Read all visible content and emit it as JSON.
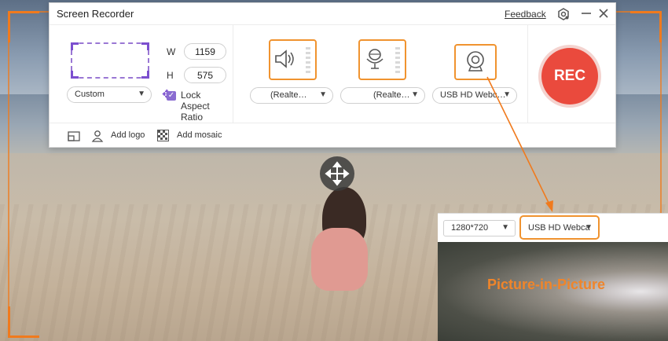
{
  "window": {
    "title": "Screen Recorder",
    "feedback": "Feedback",
    "icons": [
      "settings-icon",
      "minimize-icon",
      "close-icon"
    ]
  },
  "region": {
    "width_label": "W",
    "width_value": "1159",
    "height_label": "H",
    "height_value": "575",
    "preset": "Custom",
    "lock_aspect_label": "Lock Aspect Ratio",
    "lock_aspect_checked": true
  },
  "devices": {
    "speaker": {
      "icon": "speaker-icon",
      "select": "(Realte…"
    },
    "microphone": {
      "icon": "microphone-icon",
      "select": "(Realte…"
    },
    "webcam": {
      "icon": "webcam-icon",
      "select": "USB HD Webc…"
    }
  },
  "rec_label": "REC",
  "bottom_bar": {
    "add_logo": "Add logo",
    "add_mosaic": "Add mosaic"
  },
  "pip": {
    "resolution": "1280*720",
    "camera": "USB HD Webca",
    "caption": "Picture-in-Picture"
  },
  "colors": {
    "accent_orange": "#f07a1d",
    "rec_red": "#ea4a3d",
    "region_purple": "#9a77d4"
  }
}
